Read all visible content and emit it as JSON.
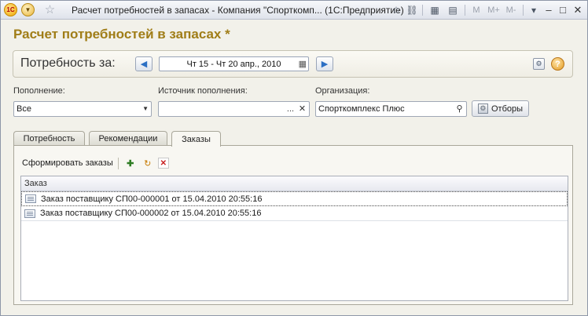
{
  "window": {
    "title": "Расчет потребностей в запасах - Компания \"Спорткомп... (1С:Предприятие)",
    "memory_buttons": [
      "M",
      "M+",
      "M-"
    ]
  },
  "form": {
    "heading": "Расчет потребностей в запасах *"
  },
  "period": {
    "label": "Потребность за:",
    "value": "Чт 15 - Чт 20 апр., 2010"
  },
  "fields": {
    "replenishment": {
      "label": "Пополнение:",
      "value": "Все"
    },
    "source": {
      "label": "Источник пополнения:",
      "value": "",
      "select_label": "..."
    },
    "organization": {
      "label": "Организация:",
      "value": "Спорткомплекс Плюс"
    },
    "filters_button": "Отборы"
  },
  "tabs": [
    {
      "label": "Потребность",
      "active": false
    },
    {
      "label": "Рекомендации",
      "active": false
    },
    {
      "label": "Заказы",
      "active": true
    }
  ],
  "orders": {
    "toolbar_action": "Сформировать заказы",
    "column_header": "Заказ",
    "rows": [
      "Заказ поставщику СП00-000001 от 15.04.2010 20:55:16",
      "Заказ поставщику СП00-000002 от 15.04.2010 20:55:16"
    ]
  },
  "colors": {
    "heading": "#a07d17",
    "window_bg": "#f2f1ea",
    "nav_arrow": "#2b6fc4"
  }
}
